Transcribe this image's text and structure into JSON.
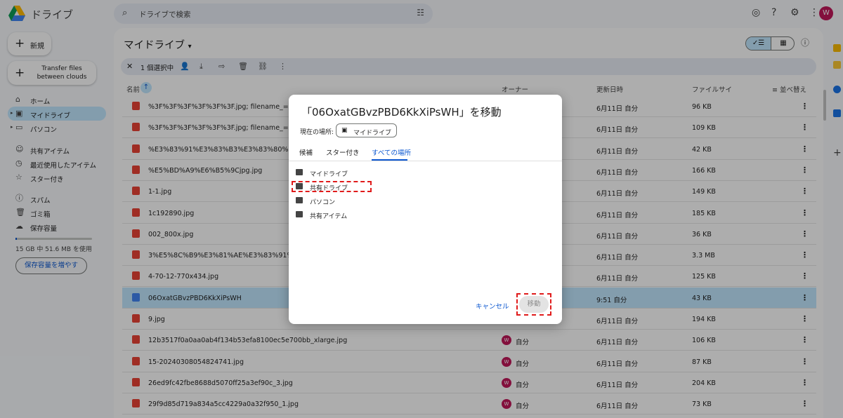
{
  "app": {
    "title": "ドライブ"
  },
  "search": {
    "placeholder": "ドライブで検索"
  },
  "sidebar": {
    "new_label": "新規",
    "transfer_label": "Transfer files between clouds",
    "items": [
      {
        "label": "ホーム",
        "icon": "home-icon"
      },
      {
        "label": "マイドライブ",
        "icon": "my-drive-icon",
        "active": true
      },
      {
        "label": "パソコン",
        "icon": "computer-icon"
      },
      {
        "label": "共有アイテム",
        "icon": "people-icon"
      },
      {
        "label": "最近使用したアイテム",
        "icon": "clock-icon"
      },
      {
        "label": "スター付き",
        "icon": "star-icon"
      },
      {
        "label": "スパム",
        "icon": "spam-icon"
      },
      {
        "label": "ゴミ箱",
        "icon": "trash-icon"
      },
      {
        "label": "保存容量",
        "icon": "cloud-icon"
      }
    ],
    "storage_text": "15 GB 中 51.6 MB を使用",
    "storage_used_fraction": 0.0034,
    "storage_button": "保存容量を増やす"
  },
  "main": {
    "title": "マイドライブ",
    "selection": "1 個選択中",
    "columns": {
      "name": "名前",
      "owner": "オーナー",
      "modified": "更新日時",
      "size": "ファイルサイ",
      "sort": "並べ替え"
    },
    "files": [
      {
        "name": "%3F%3F%3F%3F%3F%3F.jpg; filename_=UTF-8''%3F%3F",
        "owner": "",
        "date": "6月11日 自分",
        "size": "96 KB",
        "type": "image"
      },
      {
        "name": "%3F%3F%3F%3F%3F%3F.jpg; filename_=UTF-8''%3F%3F",
        "owner": "",
        "date": "6月11日 自分",
        "size": "109 KB",
        "type": "image"
      },
      {
        "name": "%E3%83%91%E3%83%B3%E3%83%80%E3%81%AE",
        "owner": "",
        "date": "6月11日 自分",
        "size": "42 KB",
        "type": "image"
      },
      {
        "name": "%E5%BD%A9%E6%B5%9Cjpg.jpg",
        "owner": "",
        "date": "6月11日 自分",
        "size": "166 KB",
        "type": "image"
      },
      {
        "name": "1-1.jpg",
        "owner": "",
        "date": "6月11日 自分",
        "size": "149 KB",
        "type": "image"
      },
      {
        "name": "1c192890.jpg",
        "owner": "",
        "date": "6月11日 自分",
        "size": "185 KB",
        "type": "image"
      },
      {
        "name": "002_800x.jpg",
        "owner": "",
        "date": "6月11日 自分",
        "size": "36 KB",
        "type": "image"
      },
      {
        "name": "3%E5%8C%B9%E3%81%AE%E3%83%91%E3%83%",
        "owner": "",
        "date": "6月11日 自分",
        "size": "3.3 MB",
        "type": "image"
      },
      {
        "name": "4-70-12-770x434.jpg",
        "owner": "",
        "date": "6月11日 自分",
        "size": "125 KB",
        "type": "image"
      },
      {
        "name": "06OxatGBvzPBD6KkXiPsWH",
        "owner": "",
        "date": "9:51 自分",
        "size": "43 KB",
        "type": "doc",
        "selected": true
      },
      {
        "name": "9.jpg",
        "owner": "",
        "date": "6月11日 自分",
        "size": "194 KB",
        "type": "image"
      },
      {
        "name": "12b3517f0a0aa0ab4f134b53efa8100ec5e700bb_xlarge.jpg",
        "owner": "自分",
        "date": "6月11日 自分",
        "size": "106 KB",
        "type": "image"
      },
      {
        "name": "15-20240308054824741.jpg",
        "owner": "自分",
        "date": "6月11日 自分",
        "size": "87 KB",
        "type": "image"
      },
      {
        "name": "26ed9fc42fbe8688d5070ff25a3ef90c_3.jpg",
        "owner": "自分",
        "date": "6月11日 自分",
        "size": "204 KB",
        "type": "image"
      },
      {
        "name": "29f9d85d719a834a5cc4229a0a32f950_1.jpg",
        "owner": "自分",
        "date": "6月11日 自分",
        "size": "73 KB",
        "type": "image"
      }
    ]
  },
  "dialog": {
    "title": "「06OxatGBvzPBD6KkXiPsWH」を移動",
    "current_location_label": "現在の場所:",
    "current_location": "マイドライブ",
    "tabs": [
      "候補",
      "スター付き",
      "すべての場所"
    ],
    "active_tab": 2,
    "locations": [
      "マイドライブ",
      "共有ドライブ",
      "パソコン",
      "共有アイテム"
    ],
    "cancel": "キャンセル",
    "move": "移動"
  },
  "user": {
    "initial": "W"
  },
  "colors": {
    "accent": "#0b57d0",
    "selected": "#c2e7ff",
    "highlight": "#e01b1b",
    "avatar": "#c2185b"
  }
}
